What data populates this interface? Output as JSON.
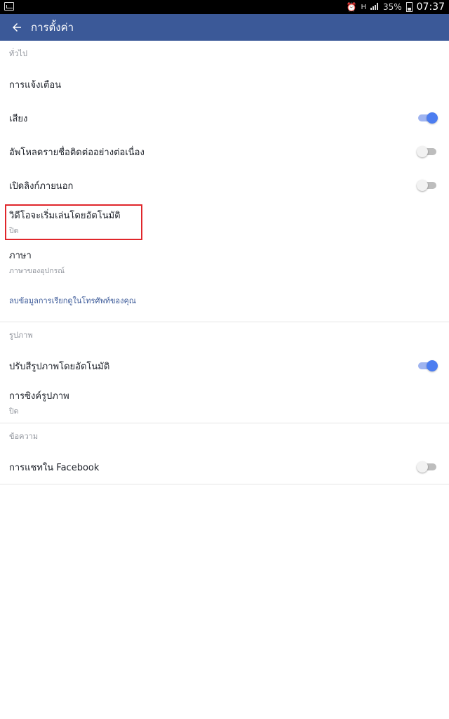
{
  "status_bar": {
    "battery_percent": "35%",
    "time": "07:37",
    "icons": [
      "image-icon",
      "alarm-icon",
      "network-h-icon",
      "signal-icon",
      "battery-icon"
    ]
  },
  "app_bar": {
    "title": "การตั้งค่า",
    "back_icon": "back-arrow-icon",
    "background": "#3b5998"
  },
  "sections": {
    "general": {
      "header": "ทั่วไป",
      "notifications": {
        "title": "การแจ้งเตือน"
      },
      "sound": {
        "title": "เสียง",
        "enabled": true
      },
      "continuous_upload": {
        "title": "อัพโหลดรายชื่อติดต่ออย่างต่อเนื่อง",
        "enabled": false
      },
      "external_links": {
        "title": "เปิดลิงก์ภายนอก",
        "enabled": false
      },
      "video_autoplay": {
        "title": "วิดีโอจะเริ่มเล่นโดยอัตโนมัติ",
        "subtitle": "ปิด"
      },
      "language": {
        "title": "ภาษา",
        "subtitle": "ภาษาของอุปกรณ์"
      },
      "delete_call_log": {
        "title": "ลบข้อมูลการเรียกดูในโทรศัพท์ของคุณ"
      }
    },
    "photos": {
      "header": "รูปภาพ",
      "auto_enhance": {
        "title": "ปรับสีรูปภาพโดยอัตโนมัติ",
        "enabled": true
      },
      "photo_sync": {
        "title": "การซิงค์รูปภาพ",
        "subtitle": "ปิด"
      }
    },
    "messages": {
      "header": "ข้อความ",
      "facebook_chat": {
        "title": "การแชทใน Facebook",
        "enabled": false
      }
    }
  },
  "colors": {
    "accent": "#3b5998",
    "toggle_on": "#4c7df0",
    "highlight": "#e0262b"
  }
}
